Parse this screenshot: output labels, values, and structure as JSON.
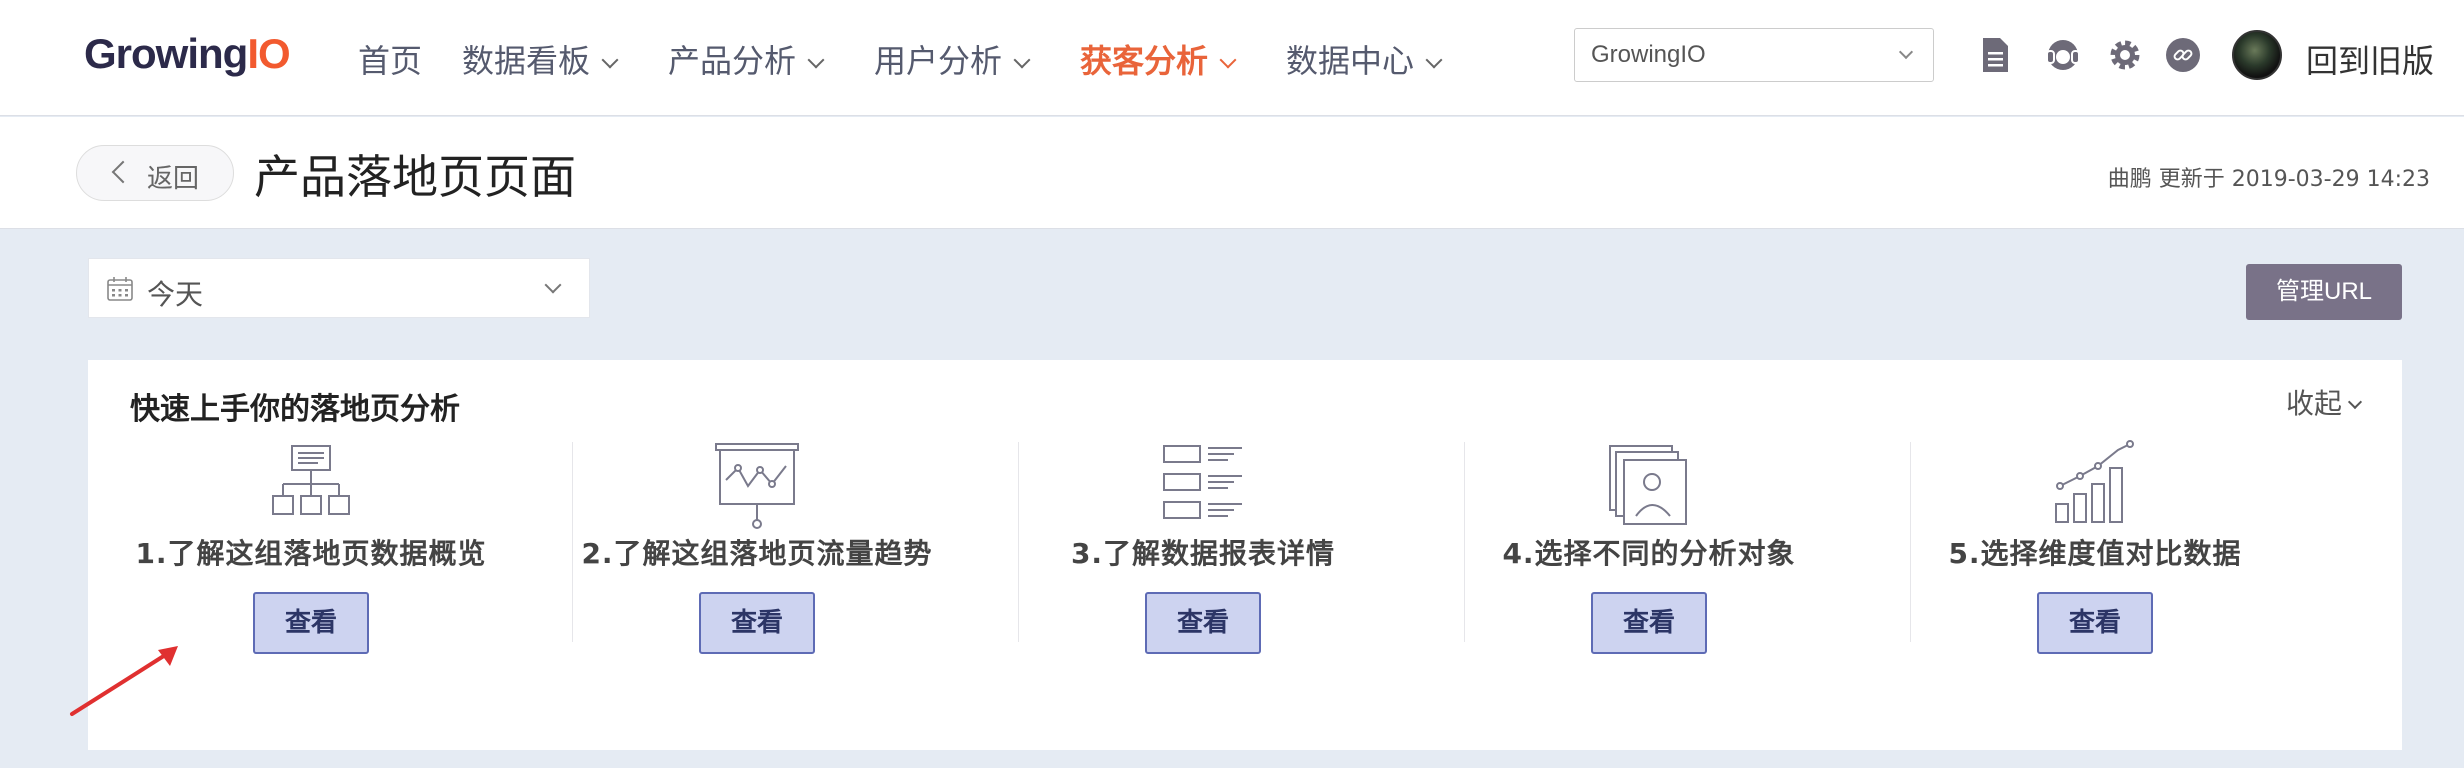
{
  "nav": {
    "logo_main": "Growing",
    "logo_accent": "IO",
    "items": [
      {
        "label": "首页",
        "dropdown": false,
        "active": false
      },
      {
        "label": "数据看板",
        "dropdown": true,
        "active": false
      },
      {
        "label": "产品分析",
        "dropdown": true,
        "active": false
      },
      {
        "label": "用户分析",
        "dropdown": true,
        "active": false
      },
      {
        "label": "获客分析",
        "dropdown": true,
        "active": true
      },
      {
        "label": "数据中心",
        "dropdown": true,
        "active": false
      }
    ],
    "project_select": "GrowingIO",
    "old_version": "回到旧版",
    "icons": [
      "document-icon",
      "headset-icon",
      "gear-icon",
      "link-icon"
    ]
  },
  "header": {
    "back_label": "返回",
    "title": "产品落地页页面",
    "updated": "曲鹏 更新于 2019-03-29 14:23"
  },
  "toolbar": {
    "date_value": "今天",
    "manage_label": "管理URL"
  },
  "guide": {
    "title": "快速上手你的落地页分析",
    "collapse_label": "收起",
    "view_label": "查看",
    "steps": [
      {
        "label": "1.了解这组落地页数据概览",
        "icon": "sitemap-icon"
      },
      {
        "label": "2.了解这组落地页流量趋势",
        "icon": "presentation-chart-icon"
      },
      {
        "label": "3.了解数据报表详情",
        "icon": "list-report-icon"
      },
      {
        "label": "4.选择不同的分析对象",
        "icon": "image-stack-icon"
      },
      {
        "label": "5.选择维度值对比数据",
        "icon": "bar-trend-icon"
      }
    ]
  },
  "colors": {
    "brand": "#2c2a4a",
    "accent": "#e9643a",
    "view_button_bg": "#cdd3f0",
    "view_button_border": "#5e6bb5",
    "manage_button": "#797288",
    "annotation_arrow": "#e03030"
  }
}
